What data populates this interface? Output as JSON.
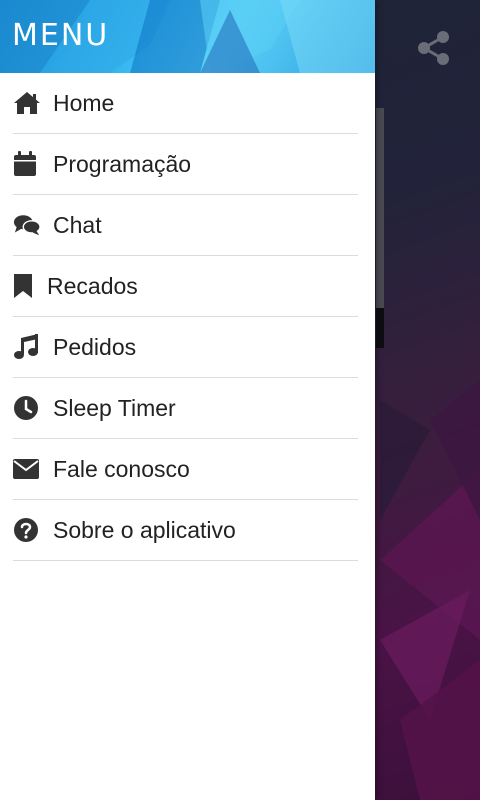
{
  "drawer": {
    "title": "MENU",
    "items": [
      {
        "label": "Home",
        "icon": "home-icon"
      },
      {
        "label": "Programação",
        "icon": "calendar-icon"
      },
      {
        "label": "Chat",
        "icon": "chat-icon"
      },
      {
        "label": "Recados",
        "icon": "bookmark-icon"
      },
      {
        "label": "Pedidos",
        "icon": "music-icon"
      },
      {
        "label": "Sleep Timer",
        "icon": "clock-icon"
      },
      {
        "label": "Fale conosco",
        "icon": "envelope-icon"
      },
      {
        "label": "Sobre o aplicativo",
        "icon": "question-circle-icon"
      }
    ]
  },
  "toolbar": {
    "share_icon": "share-icon"
  },
  "colors": {
    "header_accent": "#39b9f0",
    "icon_color": "#333333",
    "text_color": "#222222",
    "background_dark": "#1b1e2c",
    "background_purple": "#4a1346"
  }
}
